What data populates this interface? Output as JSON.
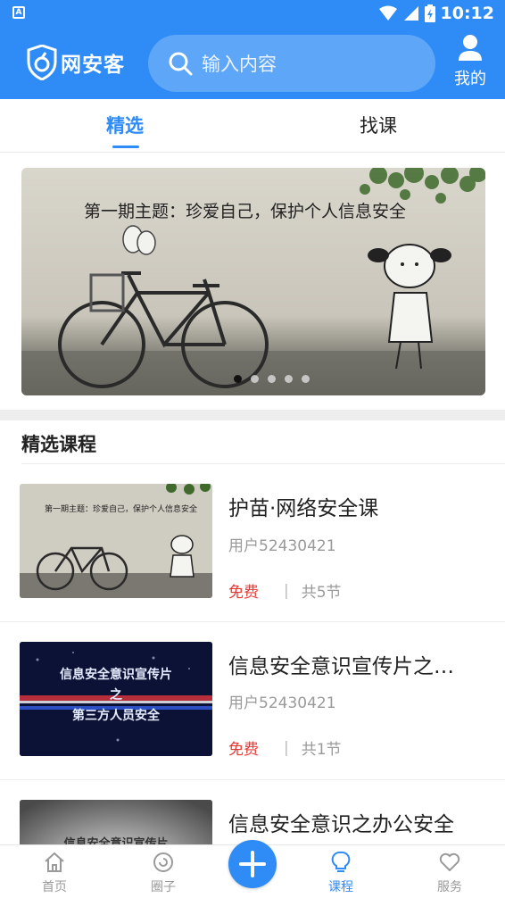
{
  "status_bar": {
    "time": "10:12"
  },
  "header": {
    "logo_text": "网安客",
    "search_placeholder": "输入内容",
    "me_label": "我的"
  },
  "tabs": [
    {
      "label": "精选",
      "active": true
    },
    {
      "label": "找课",
      "active": false
    }
  ],
  "banner": {
    "slide_text": "第一期主题：珍爱自己，保护个人信息安全",
    "dots": 5,
    "active_dot": 0
  },
  "section": {
    "title": "精选课程"
  },
  "courses": [
    {
      "title": "护苗·网络安全课",
      "author": "用户52430421",
      "price": "免费",
      "lessons": "共5节",
      "thumb_text": "第一期主题：珍爱自己，保护个人信息安全"
    },
    {
      "title": "信息安全意识宣传片之…",
      "author": "用户52430421",
      "price": "免费",
      "lessons": "共1节",
      "thumb_lines": [
        "信息安全意识宣传片",
        "之",
        "第三方人员安全"
      ]
    },
    {
      "title": "信息安全意识之办公安全",
      "thumb_text": "信息安全意识宣传片"
    }
  ],
  "bottom_nav": [
    {
      "label": "首页",
      "icon": "home-icon"
    },
    {
      "label": "圈子",
      "icon": "circle-icon"
    },
    {
      "label": "课程",
      "icon": "bulb-icon",
      "active": true
    },
    {
      "label": "服务",
      "icon": "heart-icon"
    }
  ],
  "colors": {
    "primary": "#2f8bf5",
    "price": "#e53935"
  }
}
